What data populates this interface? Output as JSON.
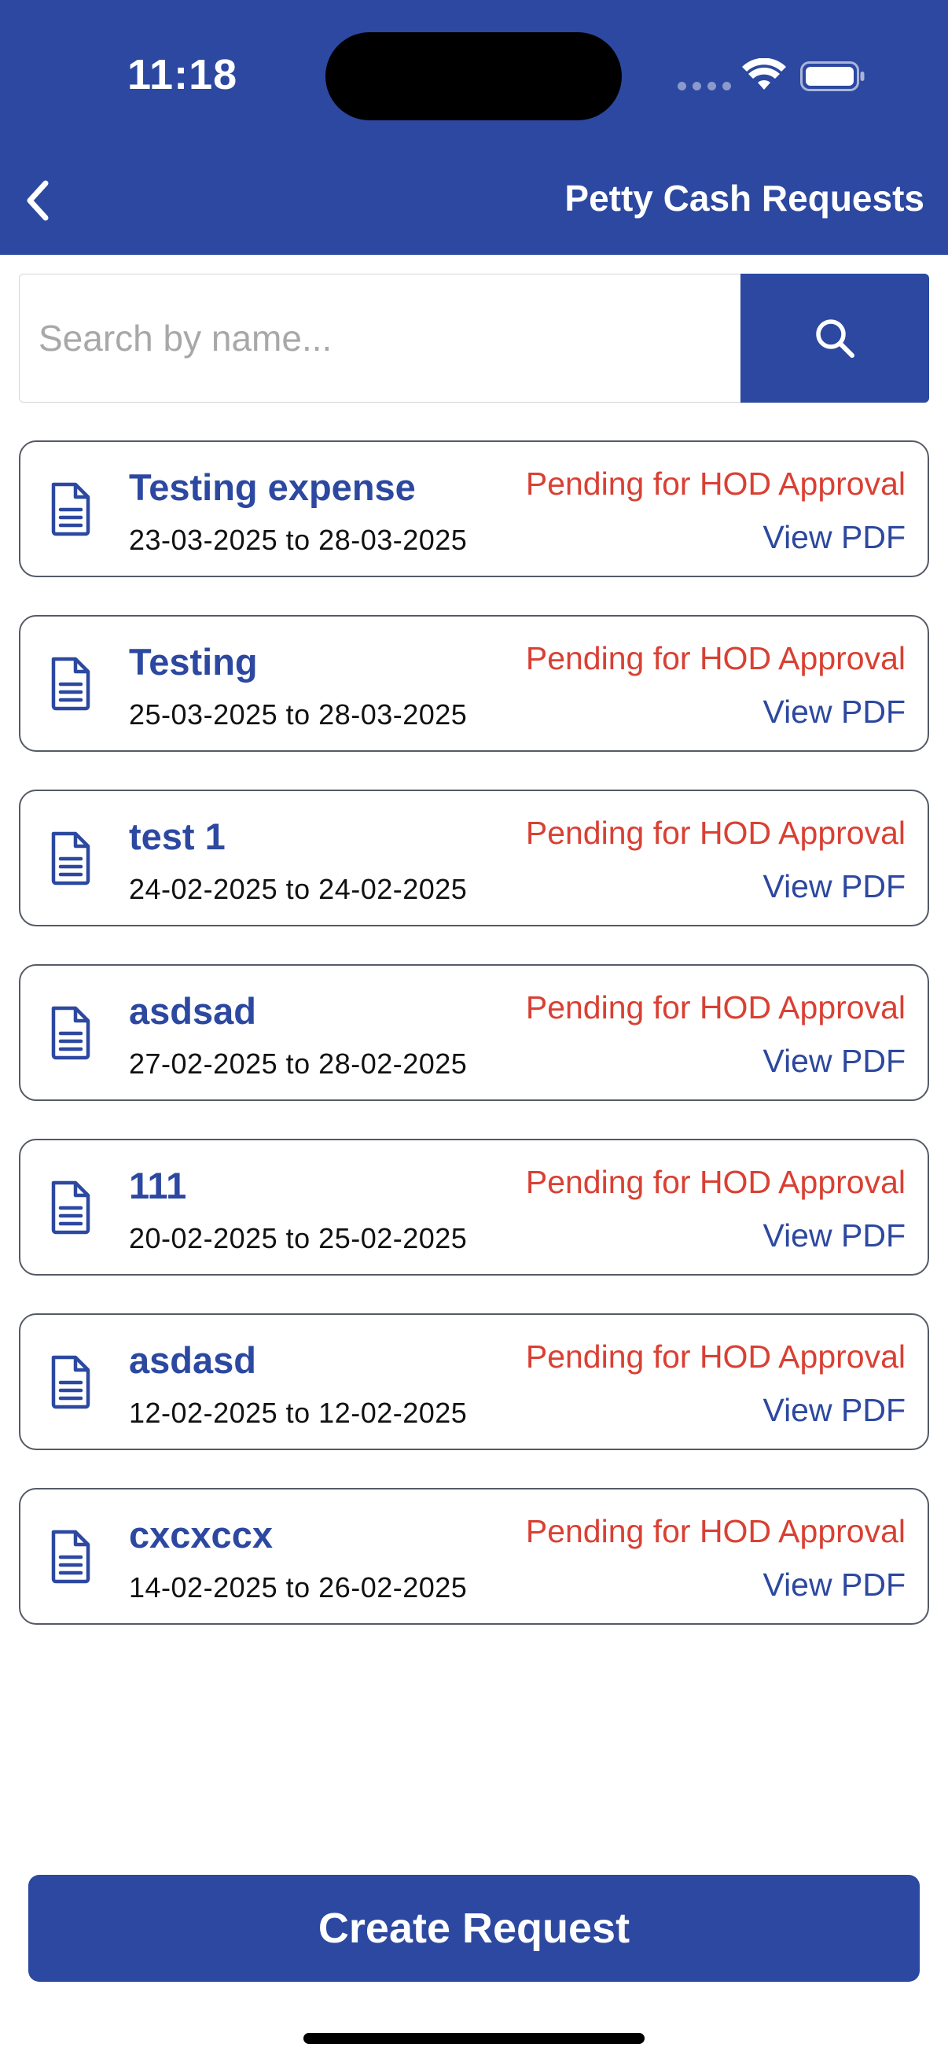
{
  "status_bar": {
    "time": "11:18"
  },
  "header": {
    "back_icon": "chevron-left-icon",
    "title": "Petty Cash Requests"
  },
  "search": {
    "placeholder": "Search by name...",
    "value": "",
    "button_icon": "search-icon"
  },
  "requests": [
    {
      "name": "Testing expense",
      "dates": "23-03-2025 to 28-03-2025",
      "status": "Pending for HOD Approval",
      "action": "View PDF"
    },
    {
      "name": "Testing",
      "dates": "25-03-2025 to 28-03-2025",
      "status": "Pending for HOD Approval",
      "action": "View PDF"
    },
    {
      "name": "test 1",
      "dates": "24-02-2025 to 24-02-2025",
      "status": "Pending for HOD Approval",
      "action": "View PDF"
    },
    {
      "name": "asdsad",
      "dates": "27-02-2025 to 28-02-2025",
      "status": "Pending for HOD Approval",
      "action": "View PDF"
    },
    {
      "name": "111",
      "dates": "20-02-2025 to 25-02-2025",
      "status": "Pending for HOD Approval",
      "action": "View PDF"
    },
    {
      "name": "asdasd",
      "dates": "12-02-2025 to 12-02-2025",
      "status": "Pending for HOD Approval",
      "action": "View PDF"
    },
    {
      "name": "cxcxccx",
      "dates": "14-02-2025 to 26-02-2025",
      "status": "Pending for HOD Approval",
      "action": "View PDF"
    }
  ],
  "footer": {
    "create_label": "Create Request"
  },
  "colors": {
    "primary": "#2c48a0",
    "status_pending": "#d94033",
    "text": "#111111"
  }
}
